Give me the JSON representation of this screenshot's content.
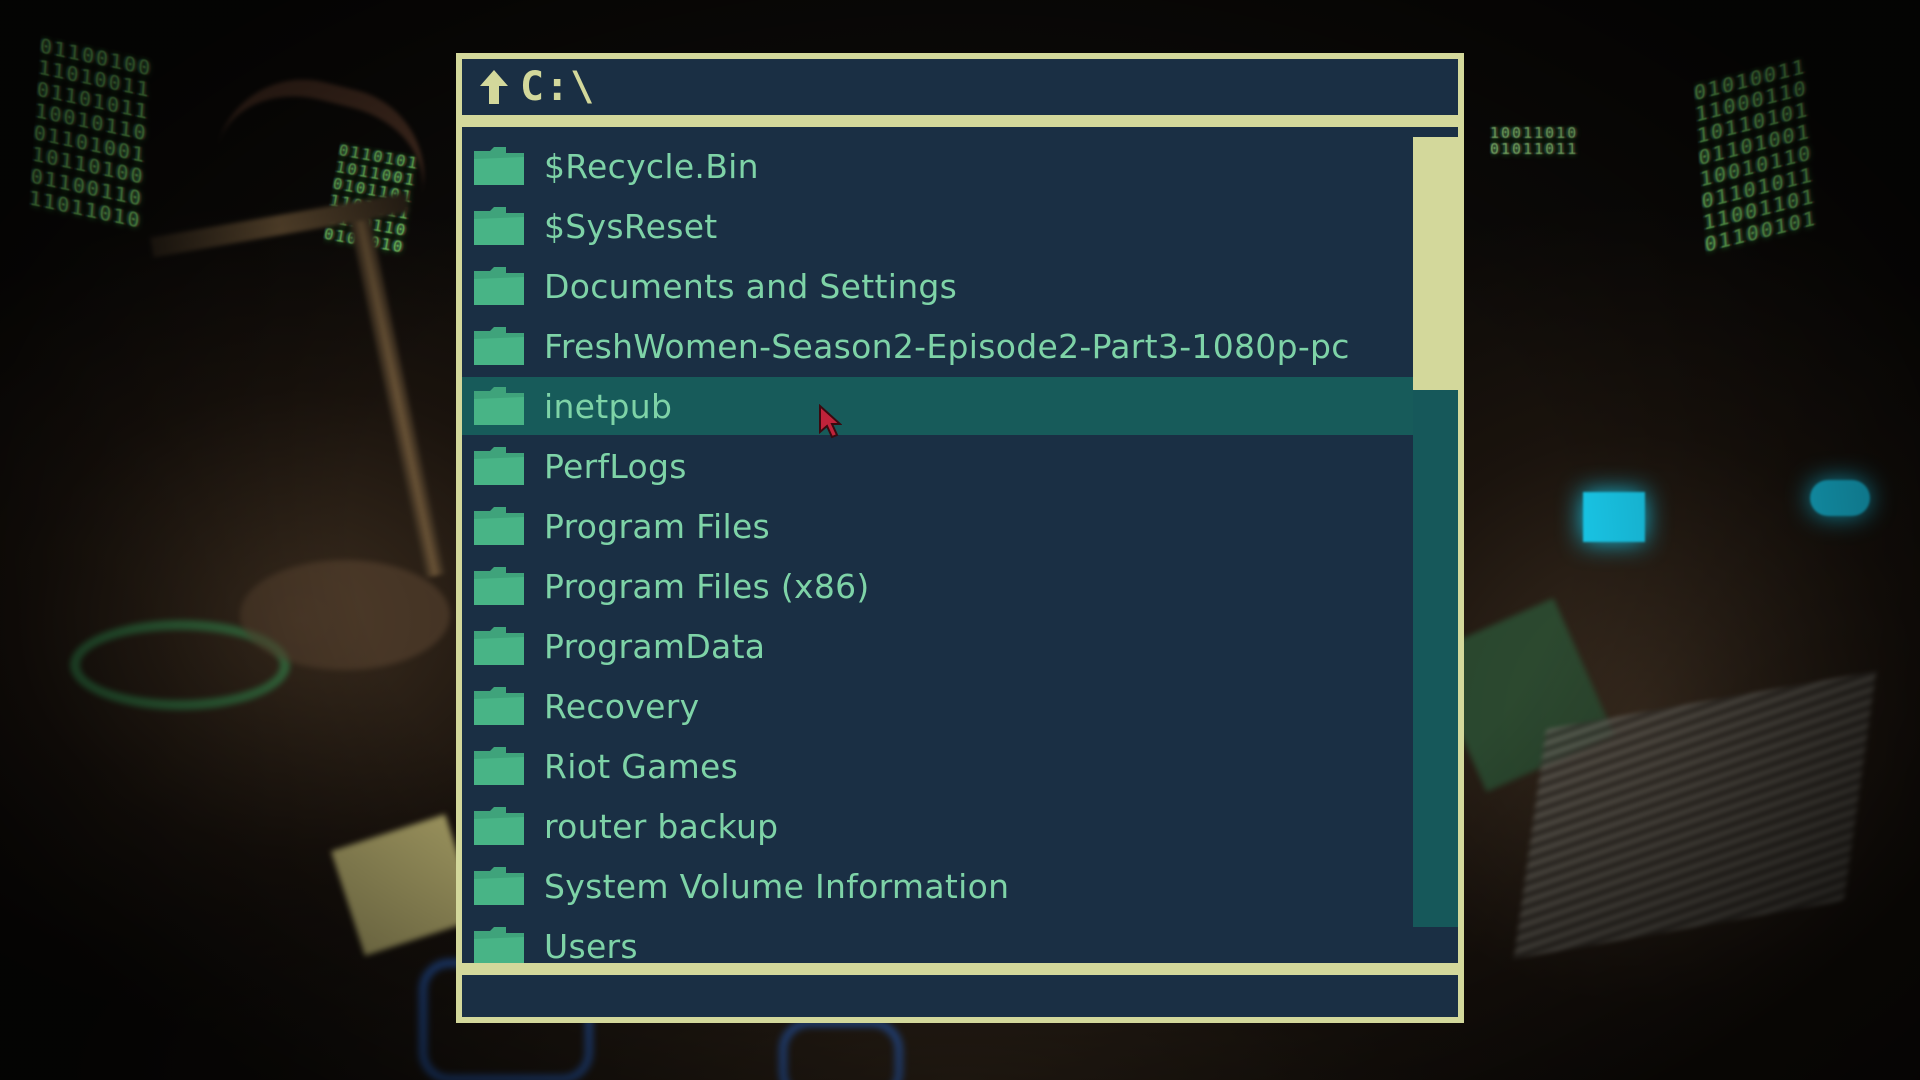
{
  "window": {
    "path": "C:\\",
    "up_icon": "up-arrow-icon",
    "selected_index": 4
  },
  "folders": [
    {
      "name": "$Recycle.Bin"
    },
    {
      "name": "$SysReset"
    },
    {
      "name": "Documents and Settings"
    },
    {
      "name": "FreshWomen-Season2-Episode2-Part3-1080p-pc"
    },
    {
      "name": "inetpub"
    },
    {
      "name": "PerfLogs"
    },
    {
      "name": "Program Files"
    },
    {
      "name": "Program Files (x86)"
    },
    {
      "name": "ProgramData"
    },
    {
      "name": "Recovery"
    },
    {
      "name": "Riot Games"
    },
    {
      "name": "router backup"
    },
    {
      "name": "System Volume Information"
    },
    {
      "name": "Users"
    }
  ],
  "scrollbar": {
    "position_fraction": 0.0,
    "visible_fraction": 0.32
  },
  "colors": {
    "frame": "#d3d89b",
    "panel": "#1a2f44",
    "text": "#7ed3a7",
    "folder": "#3fa37b",
    "selection": "#175b5a",
    "track": "#16585a"
  }
}
